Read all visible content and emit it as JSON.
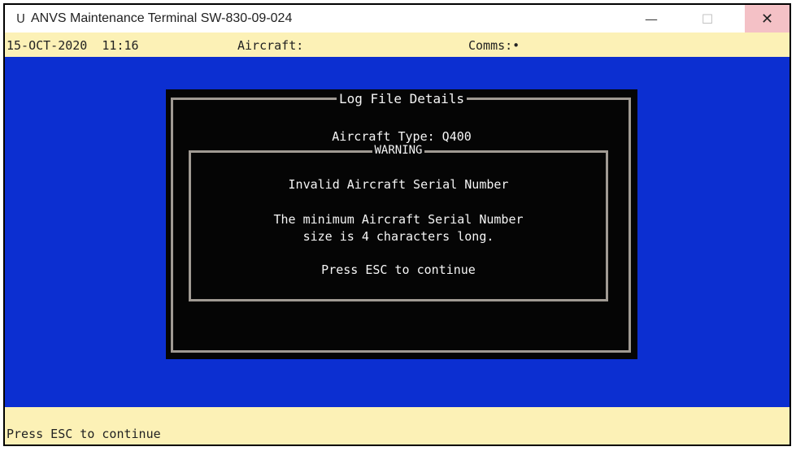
{
  "window": {
    "title": "ANVS Maintenance Terminal SW-830-09-024",
    "app_icon": "U",
    "minimize_icon": "—",
    "maximize_icon": "☐",
    "close_icon": "✕"
  },
  "status": {
    "date_time": "15-OCT-2020  11:16",
    "aircraft_label": "Aircraft:",
    "comms_label": "Comms:•"
  },
  "dialog": {
    "title": "Log File Details",
    "aircraft_type": "Aircraft Type: Q400",
    "warning": {
      "title": "WARNING",
      "line1": "Invalid Aircraft Serial Number",
      "line2": "The minimum Aircraft Serial Number",
      "line3": "size is 4 characters long.",
      "line4": "Press ESC to continue"
    }
  },
  "footer": {
    "message": "Press ESC to continue"
  },
  "colors": {
    "terminal_bg": "#0c2fd1",
    "status_bg": "#fcf1b6",
    "dialog_bg": "#050505",
    "border": "#a09a93"
  }
}
